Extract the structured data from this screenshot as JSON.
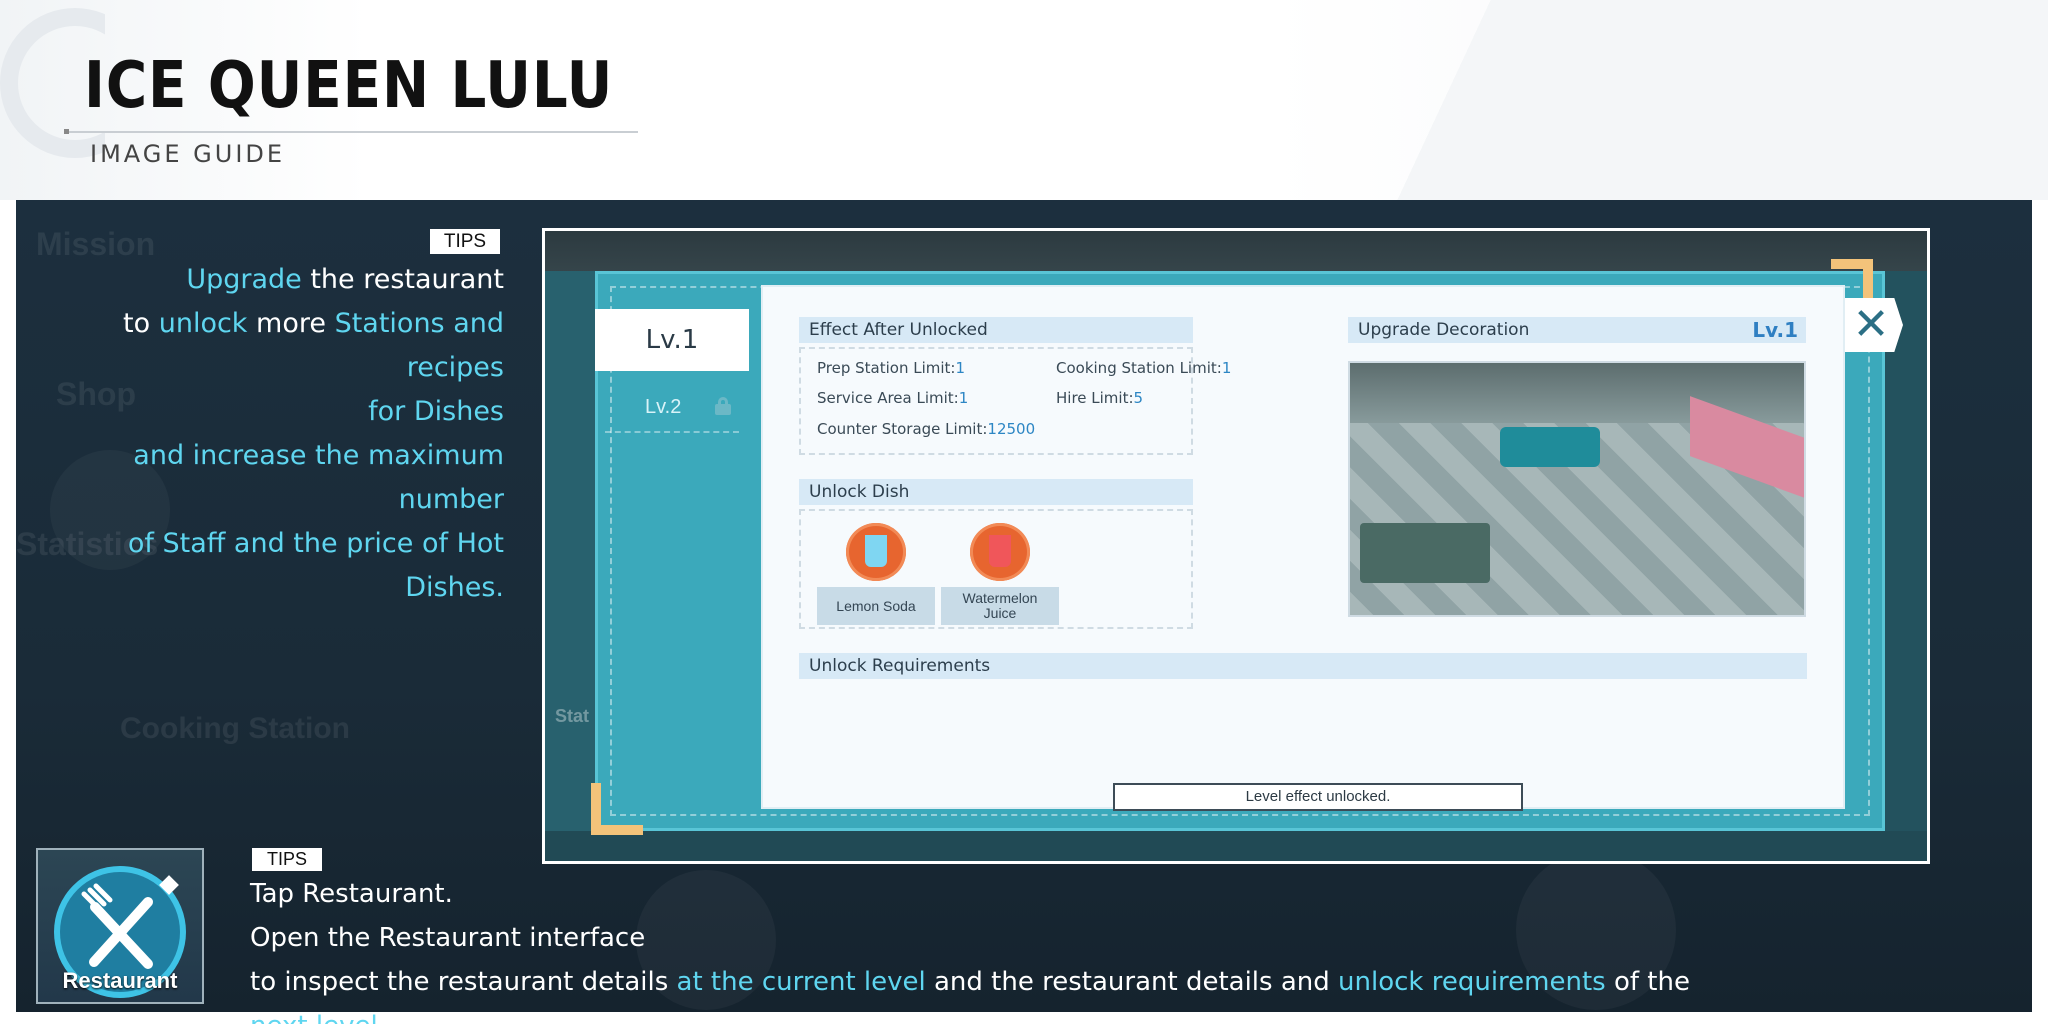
{
  "header": {
    "title": "ICE QUEEN LULU",
    "subtitle": "IMAGE GUIDE"
  },
  "background_labels": [
    "Mission",
    "Shop",
    "Statistics",
    "Cooking Station",
    "Stat"
  ],
  "tips_top": {
    "tag": "TIPS",
    "line1": {
      "hl1": "Upgrade",
      "t1": " the restaurant"
    },
    "line2": {
      "t1": "to ",
      "hl1": "unlock",
      "t2": " more ",
      "hl2": "Stations and recipes"
    },
    "line3": {
      "hl1": "for Dishes"
    },
    "line4": {
      "hl1": "and increase the maximum number"
    },
    "line5": {
      "hl1": "of Staff and the price of Hot Dishes."
    }
  },
  "game_ui": {
    "tabs": [
      {
        "label": "Lv.1",
        "active": true
      },
      {
        "label": "Lv.2",
        "active": false,
        "locked": true
      }
    ],
    "effect_section": {
      "title": "Effect After Unlocked",
      "stats": [
        {
          "label": "Prep Station Limit:",
          "value": "1"
        },
        {
          "label": "Cooking Station Limit:",
          "value": "1"
        },
        {
          "label": "Service Area Limit:",
          "value": "1"
        },
        {
          "label": "Hire Limit:",
          "value": "5"
        },
        {
          "label": "Counter Storage Limit:",
          "value": "12500"
        }
      ]
    },
    "unlock_dish": {
      "title": "Unlock Dish",
      "dishes": [
        "Lemon Soda",
        "Watermelon Juice"
      ]
    },
    "decoration": {
      "title": "Upgrade Decoration",
      "level": "Lv.1"
    },
    "requirements": {
      "title": "Unlock Requirements",
      "status": "Level effect unlocked."
    },
    "close_icon": "close-icon"
  },
  "bottom": {
    "tile_label": "Restaurant",
    "tag": "TIPS",
    "line1": "Tap Restaurant.",
    "line2": "Open the Restaurant interface",
    "line3": {
      "t1": "to inspect the restaurant details ",
      "hl1": "at the current level",
      "t2": " and the restaurant details and ",
      "hl2": "unlock requirements",
      "t3": " of the ",
      "hl3": "next level."
    }
  },
  "colors": {
    "accent": "#5fd6f0",
    "panel": "#1c2f3e",
    "teal_frame": "#3ba9bb",
    "level_blue": "#2f7fc2"
  }
}
